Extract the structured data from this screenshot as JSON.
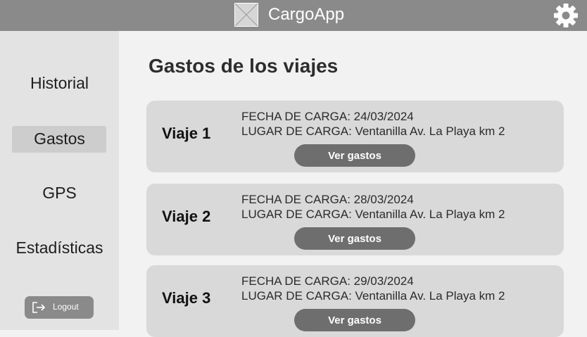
{
  "header": {
    "app_name": "CargoApp",
    "logo_icon": "image-placeholder-icon",
    "settings_icon": "gear-icon"
  },
  "sidebar": {
    "items": [
      {
        "label": "Historial",
        "active": false
      },
      {
        "label": "Gastos",
        "active": true
      },
      {
        "label": "GPS",
        "active": false
      },
      {
        "label": "Estadísticas",
        "active": false
      }
    ],
    "logout_label": "Logout",
    "logout_icon": "logout-icon"
  },
  "main": {
    "title": "Gastos de los viajes",
    "trips": [
      {
        "name": "Viaje 1",
        "fecha": "FECHA DE CARGA: 24/03/2024",
        "lugar": "LUGAR DE CARGA: Ventanilla Av. La Playa km 2",
        "button": "Ver gastos"
      },
      {
        "name": "Viaje 2",
        "fecha": "FECHA DE CARGA: 28/03/2024",
        "lugar": "LUGAR DE CARGA: Ventanilla Av. La Playa km 2",
        "button": "Ver gastos"
      },
      {
        "name": "Viaje 3",
        "fecha": "FECHA DE CARGA: 29/03/2024",
        "lugar": "LUGAR DE CARGA: Ventanilla Av. La Playa km 2",
        "button": "Ver gastos"
      }
    ]
  },
  "colors": {
    "header_bg": "#8a8a8a",
    "sidebar_bg": "#e3e3e3",
    "card_bg": "#d9d9d9",
    "button_bg": "#6e6e6e"
  }
}
